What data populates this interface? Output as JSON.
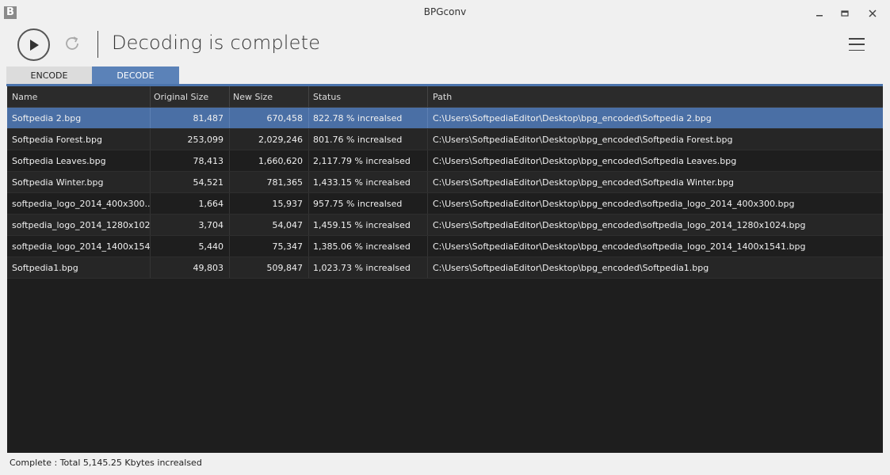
{
  "window": {
    "title": "BPGconv",
    "logo_letter": "B"
  },
  "toolbar": {
    "status_heading": "Decoding is complete"
  },
  "tabs": [
    {
      "label": "ENCODE",
      "active": false
    },
    {
      "label": "DECODE",
      "active": true
    }
  ],
  "table": {
    "columns": [
      "Name",
      "Original Size",
      "New Size",
      "Status",
      "Path"
    ],
    "rows": [
      {
        "name": "Softpedia 2.bpg",
        "original": "81,487",
        "new": "670,458",
        "status": "822.78 % increalsed",
        "path": "C:\\Users\\SoftpediaEditor\\Desktop\\bpg_encoded\\Softpedia 2.bpg",
        "selected": true
      },
      {
        "name": "Softpedia Forest.bpg",
        "original": "253,099",
        "new": "2,029,246",
        "status": "801.76 % increalsed",
        "path": "C:\\Users\\SoftpediaEditor\\Desktop\\bpg_encoded\\Softpedia Forest.bpg"
      },
      {
        "name": "Softpedia Leaves.bpg",
        "original": "78,413",
        "new": "1,660,620",
        "status": "2,117.79 % increalsed",
        "path": "C:\\Users\\SoftpediaEditor\\Desktop\\bpg_encoded\\Softpedia Leaves.bpg"
      },
      {
        "name": "Softpedia Winter.bpg",
        "original": "54,521",
        "new": "781,365",
        "status": "1,433.15 % increalsed",
        "path": "C:\\Users\\SoftpediaEditor\\Desktop\\bpg_encoded\\Softpedia Winter.bpg"
      },
      {
        "name": "softpedia_logo_2014_400x300....",
        "original": "1,664",
        "new": "15,937",
        "status": "957.75 % increalsed",
        "path": "C:\\Users\\SoftpediaEditor\\Desktop\\bpg_encoded\\softpedia_logo_2014_400x300.bpg"
      },
      {
        "name": "softpedia_logo_2014_1280x102...",
        "original": "3,704",
        "new": "54,047",
        "status": "1,459.15 % increalsed",
        "path": "C:\\Users\\SoftpediaEditor\\Desktop\\bpg_encoded\\softpedia_logo_2014_1280x1024.bpg"
      },
      {
        "name": "softpedia_logo_2014_1400x154...",
        "original": "5,440",
        "new": "75,347",
        "status": "1,385.06 % increalsed",
        "path": "C:\\Users\\SoftpediaEditor\\Desktop\\bpg_encoded\\softpedia_logo_2014_1400x1541.bpg"
      },
      {
        "name": "Softpedia1.bpg",
        "original": "49,803",
        "new": "509,847",
        "status": "1,023.73 % increalsed",
        "path": "C:\\Users\\SoftpediaEditor\\Desktop\\bpg_encoded\\Softpedia1.bpg"
      }
    ]
  },
  "statusbar": {
    "text": "Complete : Total 5,145.25 Kbytes increalsed"
  },
  "colors": {
    "accent": "#4b74ad",
    "selected_row": "#4a6fa5",
    "table_bg": "#1e1e1e"
  },
  "icons": [
    "play-icon",
    "refresh-icon",
    "hamburger-menu-icon",
    "minimize-icon",
    "maximize-icon",
    "close-icon"
  ]
}
